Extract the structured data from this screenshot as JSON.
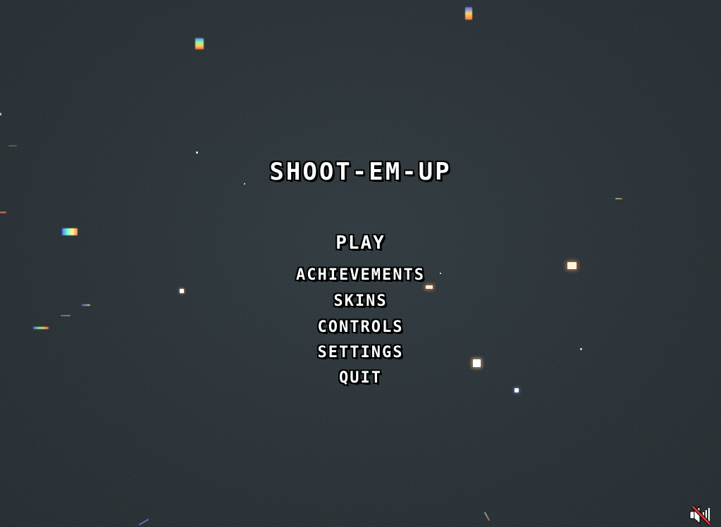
{
  "game": {
    "title": "SHOOT-EM-UP"
  },
  "menu": {
    "items": [
      {
        "id": "play",
        "label": "PLAY"
      },
      {
        "id": "achievements",
        "label": "ACHIEVEMENTS"
      },
      {
        "id": "skins",
        "label": "SKINS"
      },
      {
        "id": "controls",
        "label": "CONTROLS"
      },
      {
        "id": "settings",
        "label": "SETTINGS"
      },
      {
        "id": "quit",
        "label": "QUIT"
      }
    ]
  },
  "audio": {
    "icon": "speaker-muted-icon",
    "muted": true
  },
  "colors": {
    "background": "#1e272c",
    "text": "#ffffff",
    "text_outline": "#000000",
    "mute_slash": "#e8322a"
  }
}
